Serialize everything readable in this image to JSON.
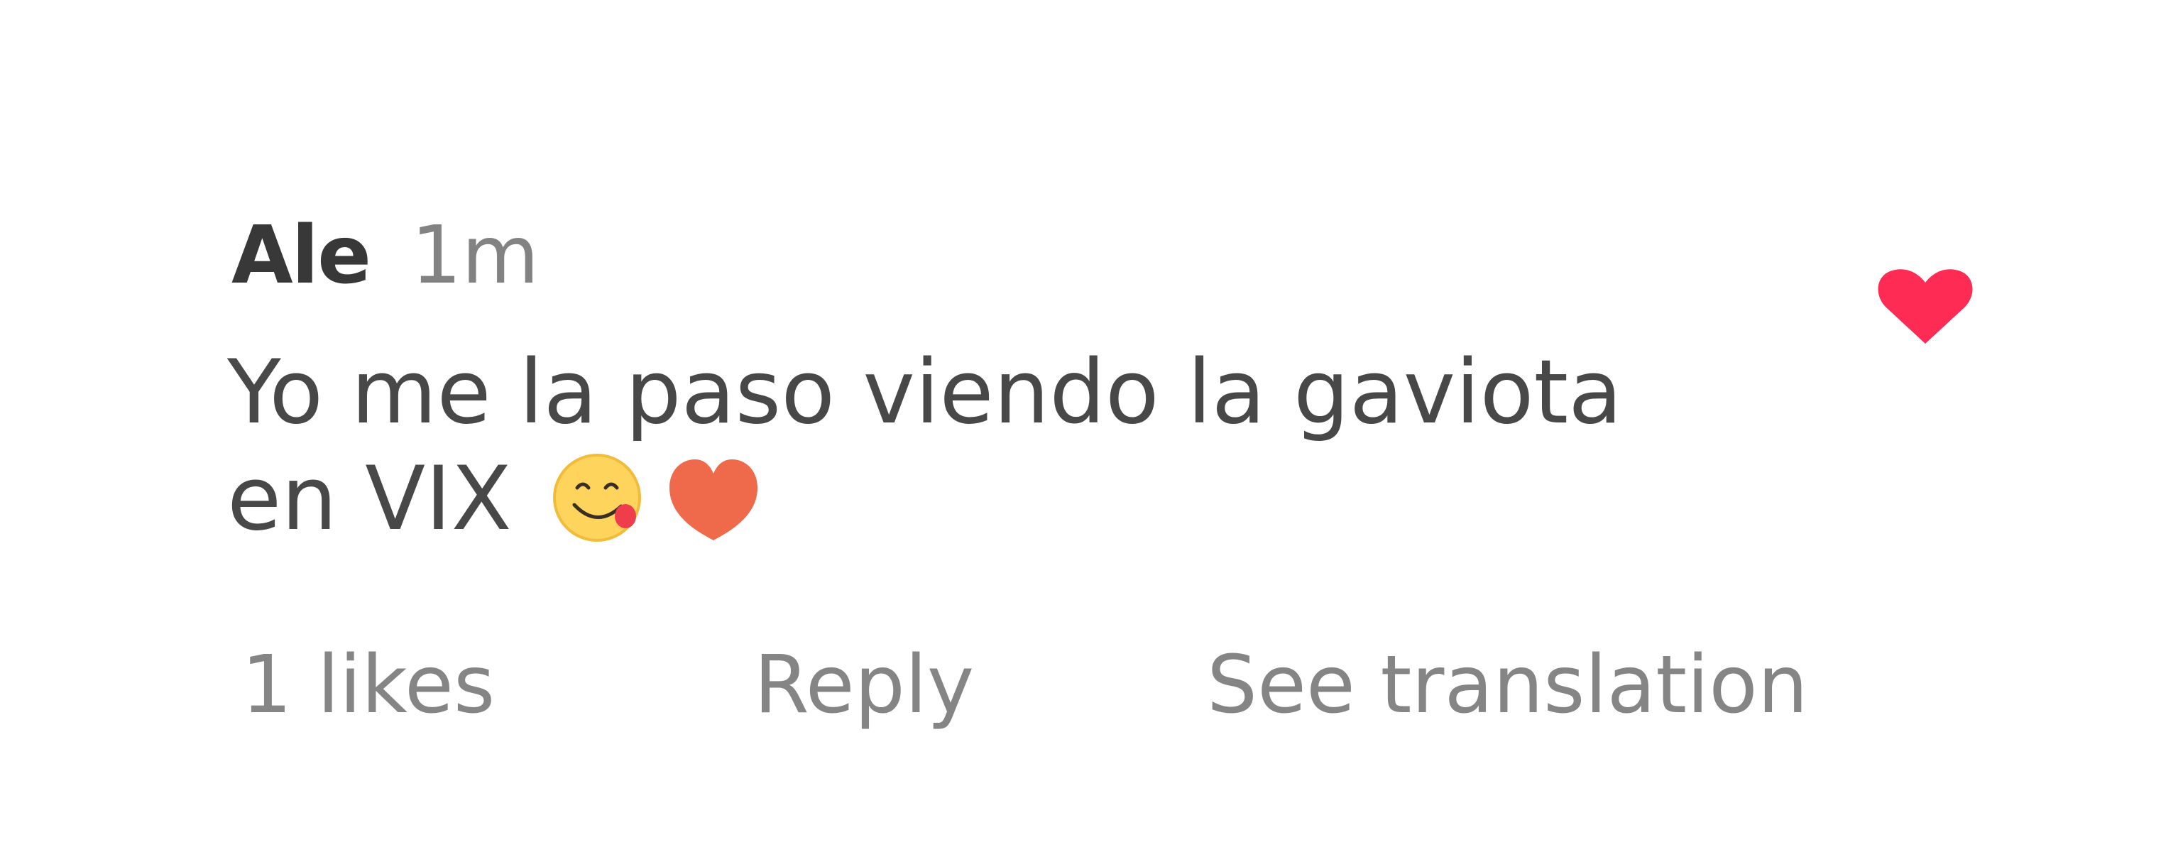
{
  "comment": {
    "username": "Ale",
    "timestamp": "1m",
    "text_line1": "Yo me la paso viendo la gaviota",
    "text_line2": "en VIX",
    "emojis": [
      "yum-face-icon",
      "orange-heart-icon"
    ]
  },
  "actions": {
    "likes_label": "1 likes",
    "reply_label": "Reply",
    "translate_label": "See translation"
  },
  "like_button": {
    "icon": "heart-icon",
    "state": "liked",
    "color": "#fe2c55"
  },
  "colors": {
    "username": "#383838",
    "timestamp": "#828282",
    "body_text": "#484848",
    "action_text": "#858585",
    "orange_heart": "#ef694b"
  }
}
